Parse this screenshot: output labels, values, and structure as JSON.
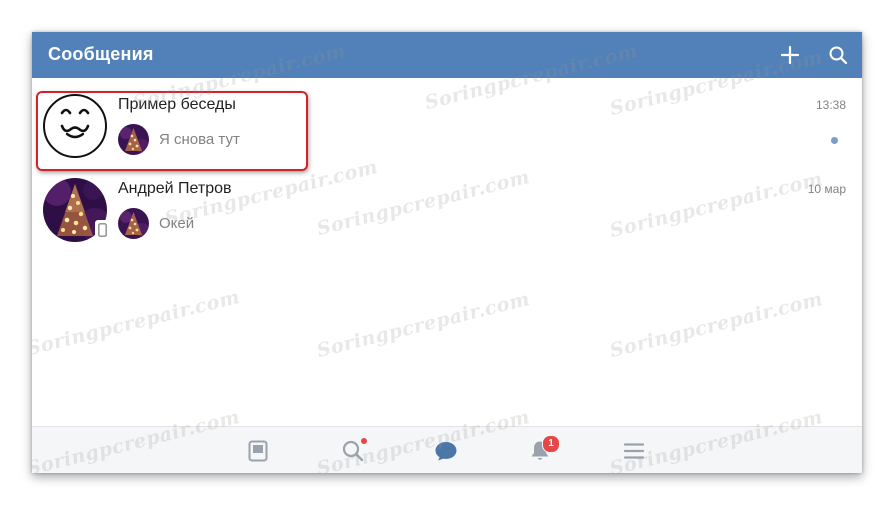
{
  "header": {
    "title": "Сообщения",
    "background": "#5181b8",
    "add_icon": "plus-icon",
    "search_icon": "search-icon"
  },
  "conversations": [
    {
      "name": "Пример беседы",
      "preview": "Я снова тут",
      "time": "13:38",
      "unread": true,
      "avatar": "smiley-face-icon"
    },
    {
      "name": "Андрей Петров",
      "preview": "Окей",
      "time": "10 мар",
      "unread": false,
      "avatar": "christmas-tree-photo",
      "online_mobile": true
    }
  ],
  "bottom_nav": {
    "items": [
      "news-icon",
      "search-icon",
      "messages-icon",
      "notifications-icon",
      "menu-icon"
    ],
    "active": "messages-icon",
    "notifications_badge": "1"
  },
  "watermark": "Soringpcrepair.com",
  "colors": {
    "accent": "#5181b8",
    "highlight": "#d6202a",
    "badge": "#e64646",
    "unread_dot": "#7a9cc6"
  }
}
